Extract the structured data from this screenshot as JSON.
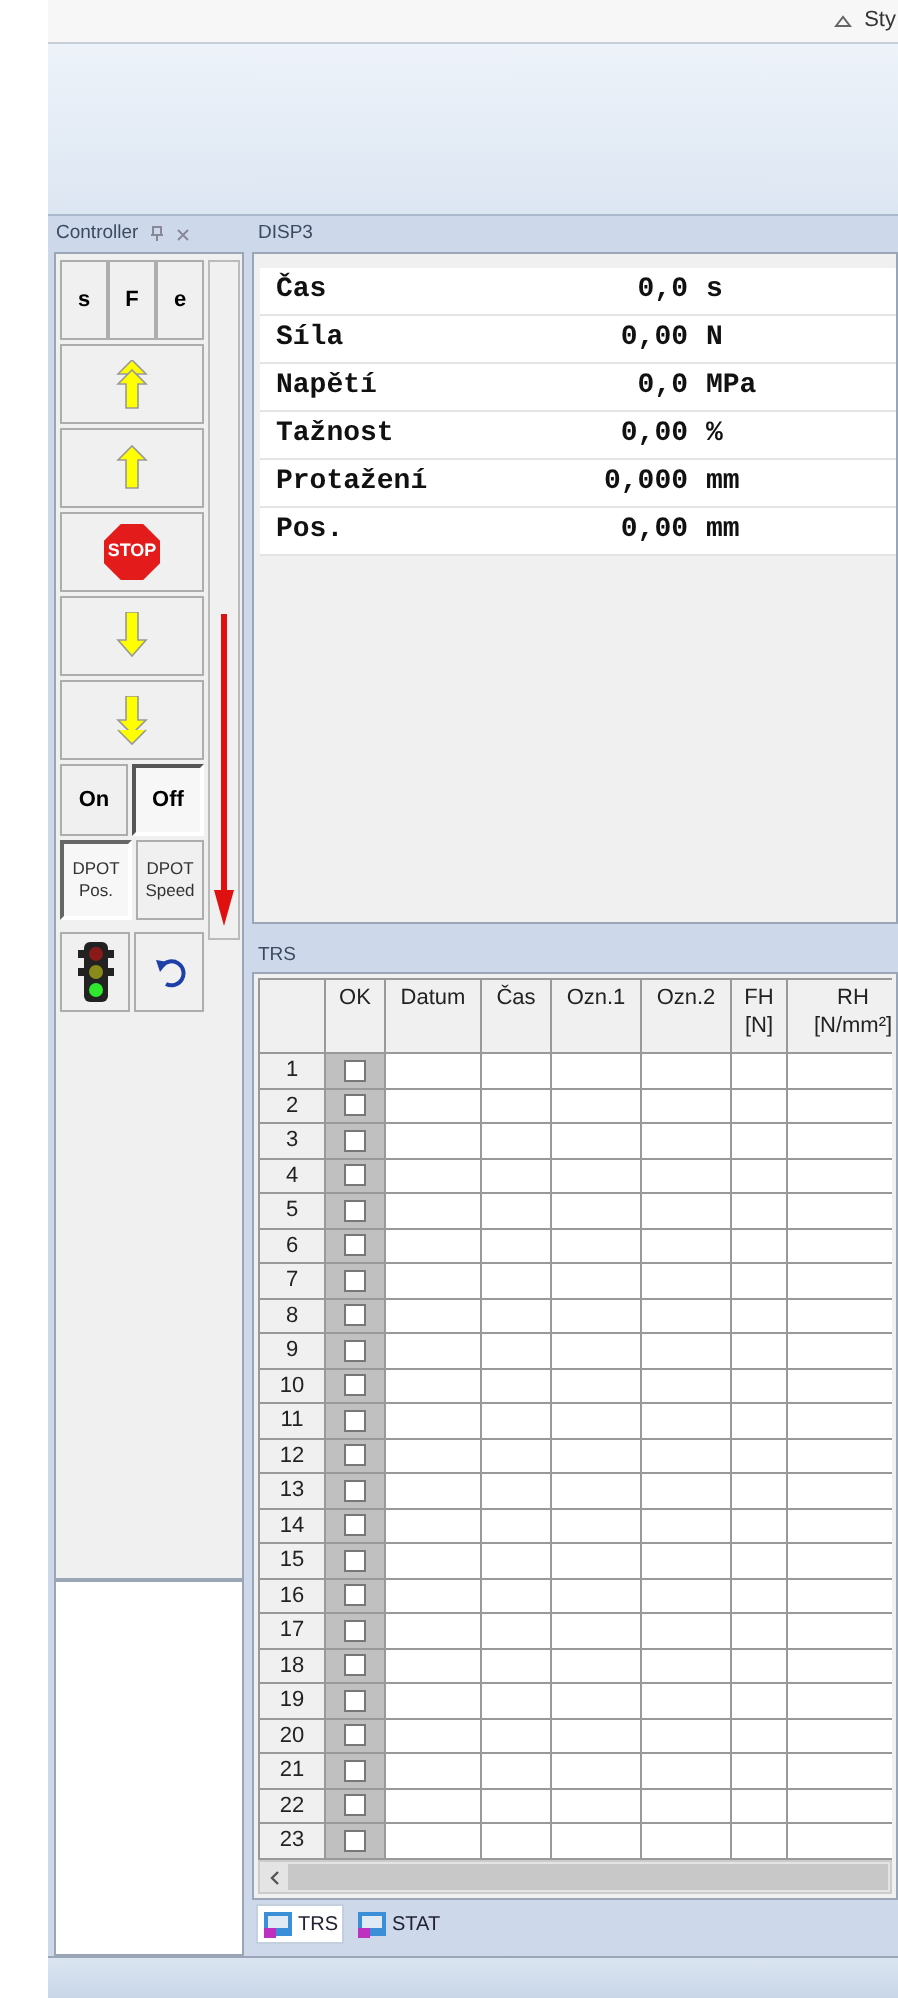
{
  "title_bar": {
    "label": "Sty"
  },
  "controller": {
    "title": "Controller",
    "mode_buttons": [
      {
        "label": "s"
      },
      {
        "label": "F"
      },
      {
        "label": "e"
      }
    ],
    "motion_buttons": [
      {
        "kind": "fast-up"
      },
      {
        "kind": "up"
      },
      {
        "kind": "stop",
        "label": "STOP"
      },
      {
        "kind": "down"
      },
      {
        "kind": "fast-down"
      }
    ],
    "power_buttons": [
      {
        "label": "On",
        "selected": false
      },
      {
        "label": "Off",
        "selected": true
      }
    ],
    "dpot_buttons": [
      {
        "lines": [
          "DPOT",
          "Pos."
        ],
        "selected": true
      },
      {
        "lines": [
          "DPOT",
          "Speed"
        ],
        "selected": false
      }
    ],
    "tool_buttons": [
      {
        "kind": "traffic-light"
      },
      {
        "kind": "undo"
      }
    ]
  },
  "disp3": {
    "title": "DISP3",
    "rows": [
      {
        "label": "Čas",
        "value": "0,0",
        "unit": "s"
      },
      {
        "label": "Síla",
        "value": "0,00",
        "unit": "N"
      },
      {
        "label": "Napětí",
        "value": "0,0",
        "unit": "MPa"
      },
      {
        "label": "Tažnost",
        "value": "0,00",
        "unit": "%"
      },
      {
        "label": "Protažení",
        "value": "0,000",
        "unit": "mm"
      },
      {
        "label": "Pos.",
        "value": "0,00",
        "unit": "mm"
      }
    ]
  },
  "trs": {
    "title": "TRS",
    "columns": [
      {
        "lines": [
          "OK"
        ]
      },
      {
        "lines": [
          "Datum"
        ]
      },
      {
        "lines": [
          "Čas"
        ]
      },
      {
        "lines": [
          "Ozn.1"
        ]
      },
      {
        "lines": [
          "Ozn.2"
        ]
      },
      {
        "lines": [
          "FH",
          "[N]"
        ]
      },
      {
        "lines": [
          "RH",
          "[N/mm²]"
        ]
      }
    ],
    "rows": [
      {
        "number": "1",
        "checked": false
      },
      {
        "number": "2",
        "checked": false
      },
      {
        "number": "3",
        "checked": false
      },
      {
        "number": "4",
        "checked": false
      },
      {
        "number": "5",
        "checked": false
      },
      {
        "number": "6",
        "checked": false
      },
      {
        "number": "7",
        "checked": false
      },
      {
        "number": "8",
        "checked": false
      },
      {
        "number": "9",
        "checked": false
      },
      {
        "number": "10",
        "checked": false
      },
      {
        "number": "11",
        "checked": false
      },
      {
        "number": "12",
        "checked": false
      },
      {
        "number": "13",
        "checked": false
      },
      {
        "number": "14",
        "checked": false
      },
      {
        "number": "15",
        "checked": false
      },
      {
        "number": "16",
        "checked": false
      },
      {
        "number": "17",
        "checked": false
      },
      {
        "number": "18",
        "checked": false
      },
      {
        "number": "19",
        "checked": false
      },
      {
        "number": "20",
        "checked": false
      },
      {
        "number": "21",
        "checked": false
      },
      {
        "number": "22",
        "checked": false
      },
      {
        "number": "23",
        "checked": false
      }
    ]
  },
  "bottom_tabs": [
    {
      "label": "TRS",
      "selected": true
    },
    {
      "label": "STAT",
      "selected": false
    }
  ]
}
